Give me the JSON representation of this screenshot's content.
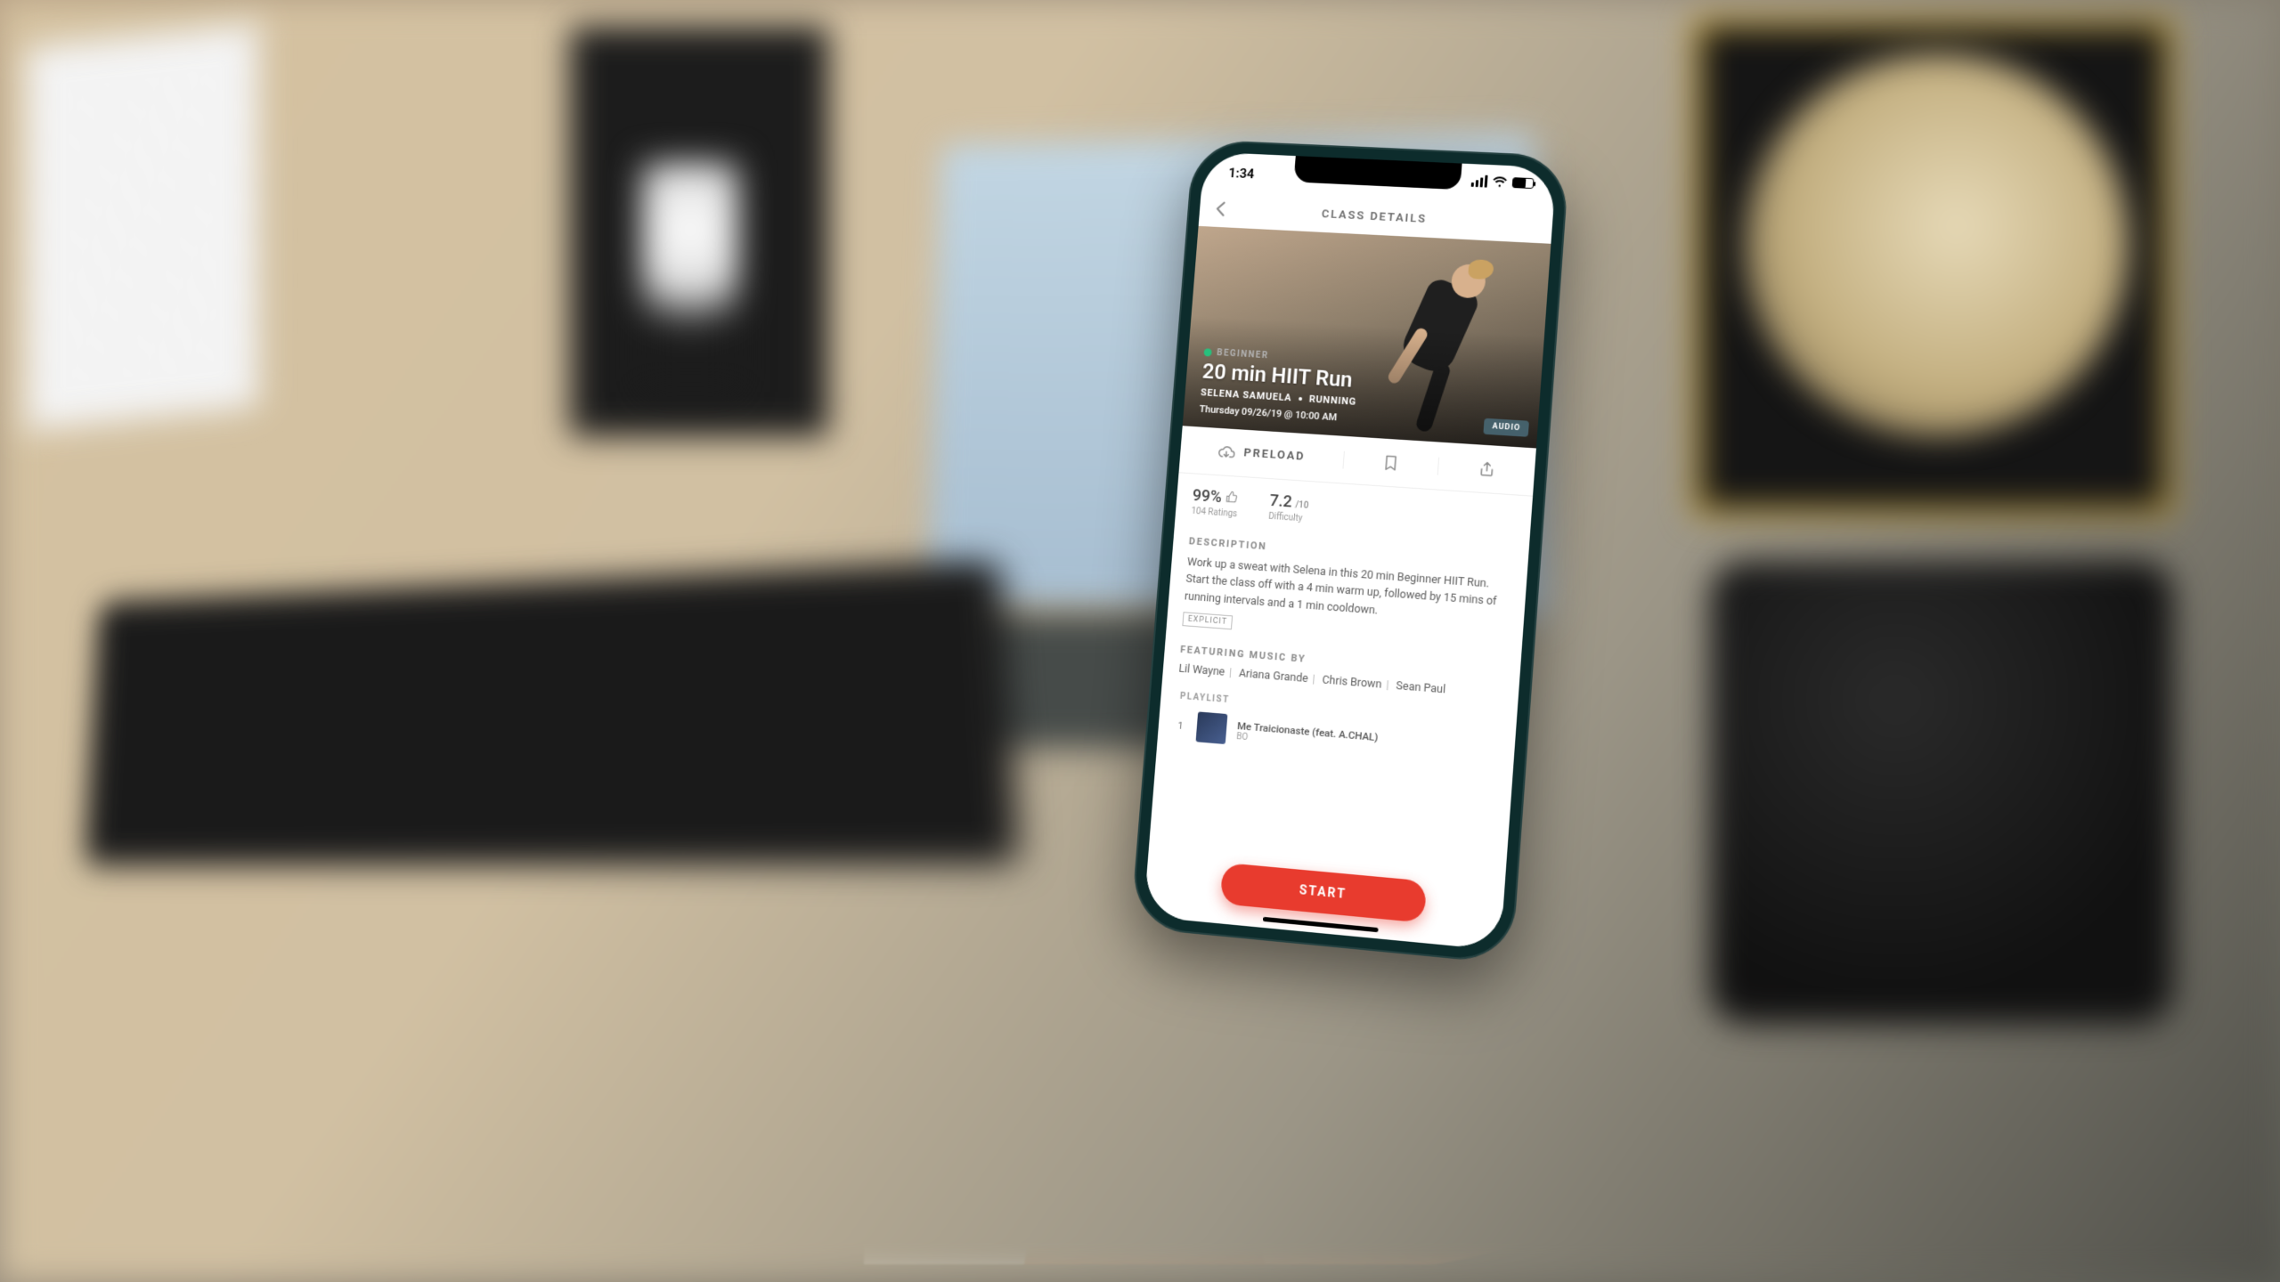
{
  "status": {
    "time": "1:34"
  },
  "nav": {
    "title": "CLASS DETAILS"
  },
  "hero": {
    "level": "BEGINNER",
    "title": "20 min HIIT Run",
    "instructor": "SELENA SAMUELA",
    "category": "RUNNING",
    "schedule": "Thursday 09/26/19 @ 10:00 AM",
    "audio_chip": "AUDIO"
  },
  "actions": {
    "preload": "PRELOAD"
  },
  "stats": {
    "rating_pct": "99%",
    "ratings_label": "104 Ratings",
    "difficulty": "7.2",
    "difficulty_sfx": "/10",
    "difficulty_label": "Difficulty"
  },
  "description": {
    "heading": "DESCRIPTION",
    "body": "Work up a sweat with Selena in this 20 min Beginner HIIT Run. Start the class off with a 4 min warm up, followed by 15 mins of running intervals and a 1 min cooldown.",
    "explicit": "EXPLICIT"
  },
  "music": {
    "heading": "FEATURING MUSIC BY",
    "artists": [
      "Lil Wayne",
      "Ariana Grande",
      "Chris Brown",
      "Sean Paul"
    ]
  },
  "playlist": {
    "heading": "PLAYLIST",
    "tracks": [
      {
        "n": "1",
        "title": "Me Traicionaste (feat. A.CHAL)",
        "artist": "BO"
      }
    ]
  },
  "start": {
    "label": "START"
  },
  "colors": {
    "accent_green": "#27c07d",
    "accent_red": "#e83b2e"
  }
}
